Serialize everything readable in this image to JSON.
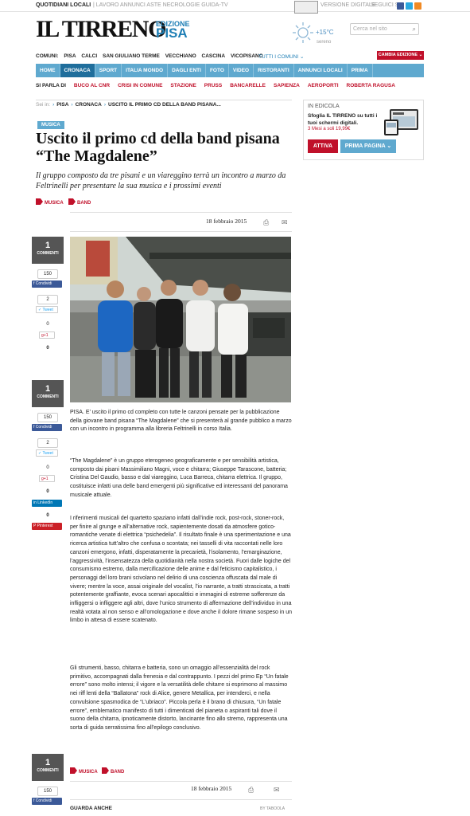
{
  "topbar": {
    "quotidiani": "QUOTIDIANI LOCALI",
    "links": "| LAVORO ANNUNCI ASTE NECROLOGIE GUIDA-TV",
    "digitale": "VERSIONE DIGITALE",
    "seguici": "SEGUICI SU"
  },
  "header": {
    "logo": "IL TIRRENO",
    "edizione": "EDIZIONE",
    "city": "PISA",
    "temp": "+15°C",
    "weather": "sereno",
    "search_placeholder": "Cerca nel sito"
  },
  "comuni": {
    "label": "COMUNI:",
    "items": [
      "PISA",
      "CALCI",
      "SAN GIULIANO TERME",
      "VECCHIANO",
      "CASCINA",
      "VICOPISANO"
    ],
    "tutti": "TUTTI I COMUNI",
    "cambia": "CAMBIA EDIZIONE"
  },
  "nav": [
    "HOME",
    "CRONACA",
    "SPORT",
    "ITALIA MONDO",
    "DAGLI ENTI",
    "FOTO",
    "VIDEO",
    "RISTORANTI",
    "ANNUNCI LOCALI",
    "PRIMA"
  ],
  "siparla": {
    "label": "SI PARLA DI",
    "items": [
      "BUCO AL CNR",
      "CRISI IN COMUNE",
      "STAZIONE",
      "PRUSS",
      "BANCARELLE",
      "SAPIENZA",
      "AEROPORTI",
      "ROBERTA RAGUSA"
    ]
  },
  "breadcrumb": {
    "label": "Sei in:",
    "items": [
      "PISA",
      "CRONACA",
      "USCITO IL PRIMO CD DELLA BAND PISANA..."
    ]
  },
  "article": {
    "section": "MUSICA",
    "title": "Uscito il primo cd della band pisana “The Magdalene”",
    "subtitle": "Il gruppo composto da tre pisani e un viareggino terrà un incontro a marzo da Feltrinelli per presentare la sua musica e i prossimi eventi",
    "tags": [
      "MUSICA",
      "BAND"
    ],
    "date": "18 febbraio 2015",
    "paragraphs": [
      "PISA. E’ uscito il primo cd completo con tutte le canzoni pensate per la pubblicazione della giovane band pisana “The Magdalene” che si presenterà al grande pubblico a marzo con un incontro in programma alla libreria Feltrinelli in corso Italia.",
      "“The Magdalene” è un gruppo eterogeneo geograficamente e per sensibilità artistica, composto dai pisani Massimiliano Magni, voce e chitarra; Giuseppe Tarascone, batteria; Cristina Del Gaudio, basso e dal viareggino, Luca Barreca, chitarra elettrica. Il gruppo, costituisce infatti una delle band emergenti più significative ed interessanti del panorama musicale attuale.",
      "I riferimenti musicali del quartetto spaziano infatti dall’indie rock, post-rock, stoner-rock, per finire al grunge e all’alternative rock, sapientemente dosati da atmosfere gotico-romantiche venate di elettrica “psichedelia”. Il risultato finale è una sperimentazione e una ricerca artistica tutt’altro che confusa o scontata; nei tasselli di vita raccontati nelle loro canzoni emergono, infatti, disperatamente la precarietà, l’isolamento, l’emarginazione, l’aggressività, l’insensatezza della quotidianità nella nostra società. Fuori dalle logiche del consumismo estremo, dalla mercificazione delle anime e dal feticismo capitalistico, i personaggi del loro brani scivolano nel delirio di una coscienza offuscata dal male di vivere; mentre la voce, assai originale del vocalist, l’io narrante, a tratti strascicata, a tratti potentemente graffiante, evoca scenari apocalittici e immagini di estreme sofferenze da infliggersi o infliggere agli altri, dove l’unico strumento di affermazione dell’individuo in una realtà votata al non senso e all’omologazione e dove anche il dolore rimane sospeso in un limbo in attesa di essere scatenato.",
      "Gli strumenti, basso, chitarra e batteria, sono un omaggio all’essenzialità del rock primitivo, accompagnati dalla frenesia e dal contrappunto. I pezzi del primo Ep “Un fatale errore” sono molto intensi; il vigore e la versatilità delle chitarre si esprimono al massimo nei riff lenti della “Ballatona” rock di Alice, genere Metallica, per intenderci, e nella convulsione spasmodica de “L’ubriaco”. Piccola perla è il brano di chiusura, “Un fatale errore”, emblematico manifesto di tutti i dimenticati del pianeta o aspiranti tali dove il suono della chitarra, ipnoticamente distorto, lancinante fino allo stremo, rappresenta una sorta di guida serratissima fino all’epilogo conclusivo."
    ]
  },
  "share": {
    "comments": "1",
    "comments_label": "COMMENTI",
    "fb_count": "150",
    "fb_label": "Condividi",
    "tw_count": "2",
    "tw_label": "Tweet",
    "gp_count": "0",
    "gp_label": "+1",
    "li_count": "0",
    "li_label": "LinkedIn",
    "pi_count": "0",
    "pi_label": "Pinterest"
  },
  "sidebar": {
    "heading": "IN EDICOLA",
    "text": "Sfoglia IL TIRRENO su tutti i tuoi schermi digitali.",
    "offer": "3 Mesi a soli 19,99€",
    "attiva": "ATTIVA",
    "prima_pagina": "PRIMA PAGINA"
  },
  "footer": {
    "guarda": "GUARDA ANCHE",
    "taboola": "BY TABOOLA"
  },
  "colors": {
    "brand_blue": "#5fa9cf",
    "nav_active": "#1f6e9c",
    "accent_red": "#c0102a",
    "fb": "#3b5998"
  }
}
